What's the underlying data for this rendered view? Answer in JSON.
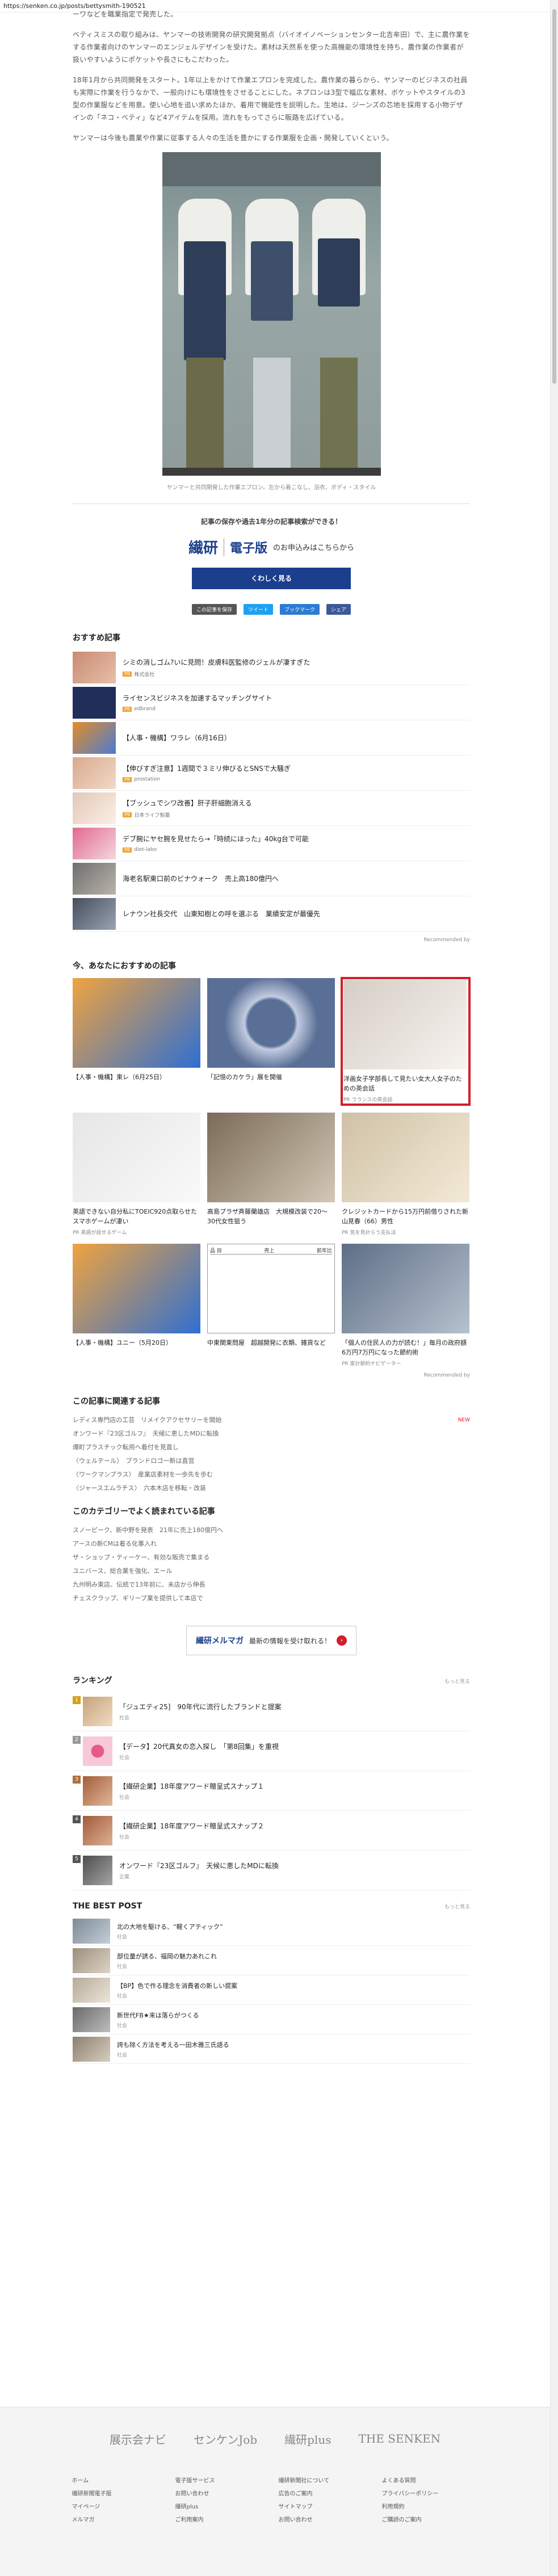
{
  "url": "https://senken.co.jp/posts/bettysmith-190521",
  "article": {
    "intro_fragment": "ーワなどを職業指定で発売した。",
    "paragraphs": [
      "ベティスミスの取り組みは、ヤンマーの技術開発の研究開発拠点（バイオイノベーションセンター北吉牟田）で、主に農作業をする作業者向けのヤンマーのエンジェルデザインを受けた。素材は天然系を使った高機能の環境性を持ち、農作業の作業者が扱いやすいようにポケットや長さにもこだわった。",
      "18年1月から共同開発をスタート。1年以上をかけて作業エプロンを完成した。農作業の暮らから、ヤンマーのビジネスの社員も実際に作業を行うなかで、一般向けにも環境性をさせることにした。ネプロンは3型で幅広な素材、ボケットやスタイルの3型の作業服などを用意。使い心地を追い求めたほか、着用で機能性を説明した。生地は、ジーンズの芯地を採用する小物デザインの「ネコ・ベティ」など4アイテムを採用。流れをもってさらに販路を広げている。",
      "ヤンマーは今後も農業や作業に従事する人々の生活を豊かにする作業服を企画・開発していくという。"
    ],
    "photo_caption": "ヤンマーと共同開発した作業エプロン。左から着こなし、浴衣、ボディ・スタイル"
  },
  "promo": {
    "lead_prefix": "記事の保存や過去1年分の記事検索ができる！",
    "brand_logo": "繊研",
    "brand_edition": "電子版",
    "brand_tail": "のお申込みはこちらから",
    "button_label": "くわしく見る"
  },
  "share": {
    "hatena": "この記事を保存",
    "tweet": "ツイート",
    "bookmark": "ブックマーク",
    "facebook": "シェア"
  },
  "recommended": {
    "heading": "おすすめ記事",
    "items": [
      {
        "title": "シミの消しゴム?いに見問！皮膚科医監修のジェルが凄すぎた",
        "pr": true,
        "source": "株式会社"
      },
      {
        "title": "ライセンスビジネスを加速するマッチングサイト",
        "pr": true,
        "source": "edbrand"
      },
      {
        "title": "【人事・機構】ワラレ（6月16日）",
        "pr": false,
        "source": ""
      },
      {
        "title": "【伸びすぎ注意】1週間で３ミリ伸びるとSNSで大騒ぎ",
        "pr": true,
        "source": "prostation"
      },
      {
        "title": "【ブッシュでシワ改善】肝子肝細胞消える",
        "pr": true,
        "source": "日本ライフ製薬"
      },
      {
        "title": "デブ腕にヤセ腕を見せたら→「時続にほった」40kg台で可能",
        "pr": true,
        "source": "diet-labo"
      },
      {
        "title": "海老名駅東口前のビナウォーク　売上高180億円へ",
        "pr": false,
        "source": ""
      },
      {
        "title": "レナウン社長交代　山東知樹との呼を選ぶる　業績安定が最優先",
        "pr": false,
        "source": ""
      }
    ],
    "recommended_by": "Recommended by"
  },
  "for_you": {
    "heading": "今、あなたにおすすめの記事",
    "cards": [
      {
        "title": "【人事・機構】東レ（6月25日）",
        "source": ""
      },
      {
        "title": "「記憶のカケラ」展を開催",
        "source": ""
      },
      {
        "title": "洋画女子学部長して見たい女大人女子のための英会話",
        "source": "PR ラランスの英会話"
      },
      {
        "title": "英語できない自分私にTOEIC920点取らせたスマホゲームが凄い",
        "source": "PR 英語が話せるゲーム"
      },
      {
        "title": "高島プラザ斉藤蘭雄店　大規模改装で20〜30代女性狙う",
        "source": ""
      },
      {
        "title": "クレジットカードから15万円前借りされた新山見春（66）男性",
        "source": "PR 気を見計らう支払法"
      },
      {
        "title": "【人事・機構】ユニー（5月20日）",
        "source": ""
      },
      {
        "title": "中東関東問屋　超越開発に衣類、雑貨など",
        "source": ""
      },
      {
        "title": "「個人の住民人の力が読む！」毎月の政府額6万円7万円になった節約術",
        "source": "PR 家計節約ナビゲーター"
      }
    ],
    "table_labels": [
      "品 目",
      "売上",
      "前年比"
    ],
    "recommended_by": "Recommended by"
  },
  "related": {
    "heading": "この記事に関連する記事",
    "items": [
      {
        "title": "レディス専門店の工芸　リメイクアクセサリーを開始",
        "new": true
      },
      {
        "title": "オンワード『23区ゴルフ』　天候に恵したMDに転換",
        "new": false
      },
      {
        "title": "爆町プラスチック転用へ着付を見直し",
        "new": false
      },
      {
        "title": "〈ウェルテール〉　ブランドロゴ一新は直営",
        "new": false
      },
      {
        "title": "〈ワークマンプラス〉　産業店素材を一歩先を歩む",
        "new": false
      },
      {
        "title": "〈ジャースエムラチス〉　六本木店を移転・改装",
        "new": false
      }
    ],
    "new_label": "NEW"
  },
  "category_popular": {
    "heading": "このカテゴリーでよく読まれている記事",
    "items": [
      "スノーピーク、新中野を発表　21年に売上180億円へ",
      "アースの新CMは着る化事入れ",
      "ザ・ショップ・ティーケー、有効な販売で集まる",
      "ユニバース、総合業を強化、エール",
      "九州明み東店、伝統で13年前に、未店から伸長",
      "チェスクラップ、ギリーブ業を提供して本店で"
    ]
  },
  "mail_banner": {
    "brand": "繊研メルマガ",
    "text": "最新の情報を受け取れる！",
    "go": "›"
  },
  "ranking": {
    "heading": "ランキング",
    "more": "もっと見る",
    "items": [
      {
        "rank": "1",
        "title": "「ジュエティ25]　90年代に流行したブランドと提案",
        "source": "社会"
      },
      {
        "rank": "2",
        "title": "【データ】20代真女の恋入探し　「第8回集」を重視",
        "source": "社会"
      },
      {
        "rank": "3",
        "title": "【繊研企業】18年度アワード贈呈式スナップ１",
        "source": "社会"
      },
      {
        "rank": "4",
        "title": "【繊研企業】18年度アワード贈呈式スナップ２",
        "source": "社会"
      },
      {
        "rank": "5",
        "title": "オンワード『23区ゴルフ』　天候に恵したMDに転換",
        "source": "企業"
      }
    ]
  },
  "best_post": {
    "heading": "THE BEST POST",
    "more": "もっと見る",
    "items": [
      {
        "title": "北の大地を駆ける、“軽くアティック”",
        "source": "社会"
      },
      {
        "title": "部位量が誘る、福岡の魅力あれこれ",
        "source": "社会"
      },
      {
        "title": "【BP】色で作る理念を消費者の新しい提案",
        "source": "社会"
      },
      {
        "title": "新世代FB★来は落らがつくる",
        "source": "社会"
      },
      {
        "title": "誇も除く方法を考える一田木雅三氏語る",
        "source": "社会"
      }
    ]
  },
  "footer": {
    "logos": [
      "展示会ナビ",
      "センケンJob",
      "繊研plus",
      "THE SENKEN"
    ],
    "links": [
      "ホーム",
      "電子版サービス",
      "繊研新聞社について",
      "よくある質問",
      "繊研新聞電子版",
      "お問い合わせ",
      "広告のご案内",
      "プライバシーポリシー",
      "マイページ",
      "繊研plus",
      "サイトマップ",
      "利用規約",
      "メルマガ",
      "ご利用案内",
      "お問い合わせ",
      "ご購読のご案内"
    ]
  },
  "colors": {
    "brand_blue": "#1b3f8c",
    "highlight_red": "#d11e2b"
  }
}
